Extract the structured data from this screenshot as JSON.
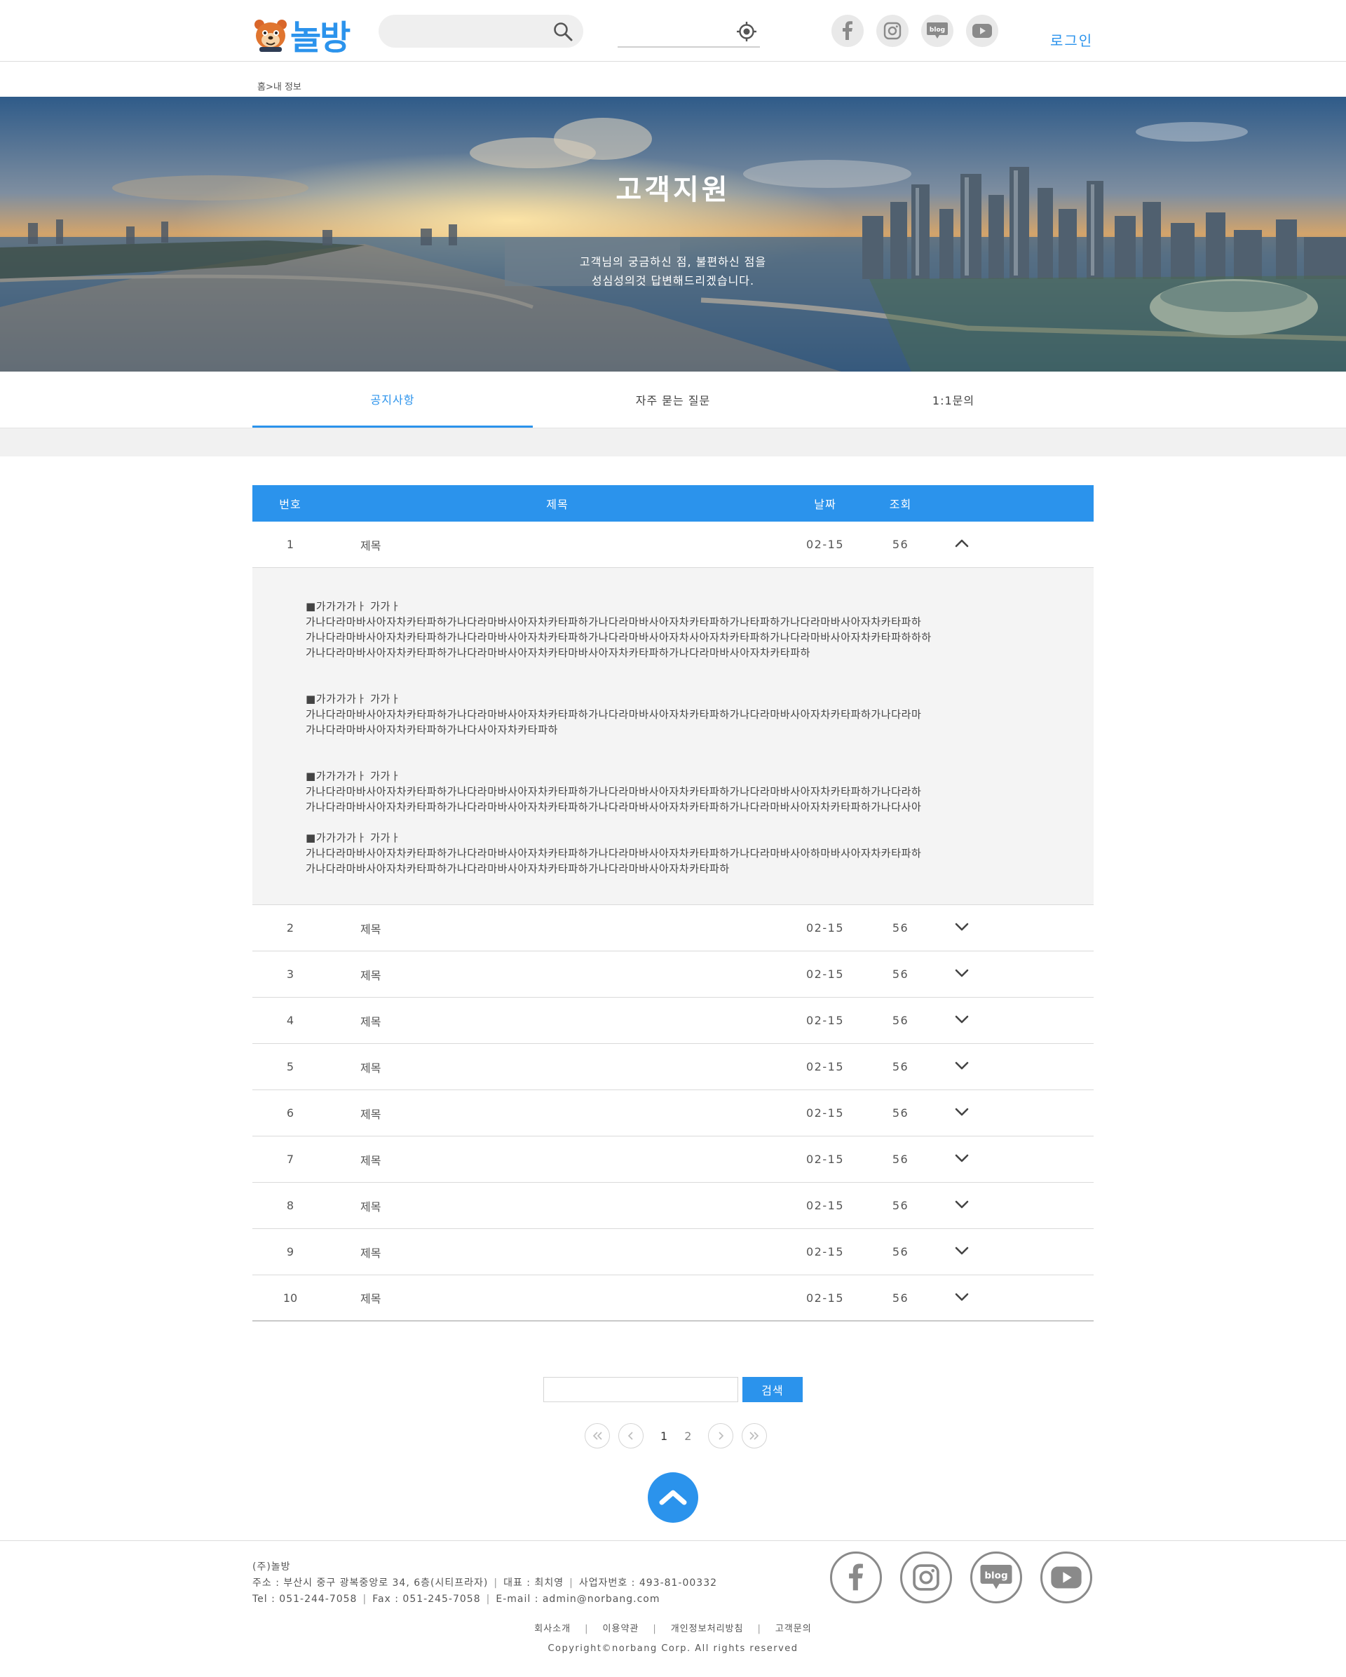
{
  "header": {
    "logo_text": "놀방",
    "search_placeholder": "",
    "location_placeholder": "",
    "sns": [
      "facebook-icon",
      "instagram-icon",
      "blog-icon",
      "youtube-icon"
    ],
    "login_label": "로그인",
    "blog_label": "blog"
  },
  "breadcrumb": "홈>내 정보",
  "hero": {
    "title": "고객지원",
    "desc_line1": "고객님의 궁금하신 점, 불편하신 점을",
    "desc_line2": "성심성의것 답변해드리겠습니다."
  },
  "tabs": [
    {
      "label": "공지사항",
      "active": true
    },
    {
      "label": "자주 묻는 질문",
      "active": false
    },
    {
      "label": "1:1문의",
      "active": false
    }
  ],
  "board": {
    "headers": {
      "num": "번호",
      "title": "제목",
      "date": "날짜",
      "views": "조회"
    },
    "rows": [
      {
        "num": "1",
        "title": "제목",
        "date": "02-15",
        "views": "56",
        "expanded": true
      },
      {
        "num": "2",
        "title": "제목",
        "date": "02-15",
        "views": "56"
      },
      {
        "num": "3",
        "title": "제목",
        "date": "02-15",
        "views": "56"
      },
      {
        "num": "4",
        "title": "제목",
        "date": "02-15",
        "views": "56"
      },
      {
        "num": "5",
        "title": "제목",
        "date": "02-15",
        "views": "56"
      },
      {
        "num": "6",
        "title": "제목",
        "date": "02-15",
        "views": "56"
      },
      {
        "num": "7",
        "title": "제목",
        "date": "02-15",
        "views": "56"
      },
      {
        "num": "8",
        "title": "제목",
        "date": "02-15",
        "views": "56"
      },
      {
        "num": "9",
        "title": "제목",
        "date": "02-15",
        "views": "56"
      },
      {
        "num": "10",
        "title": "제목",
        "date": "02-15",
        "views": "56"
      }
    ],
    "answer": [
      {
        "heading": "■가가가가ㅏ 가가ㅏ",
        "lines": [
          "가나다라마바사아자차카타파하가나다라마바사아자차카타파하가나다라마바사아자차카타파하가나타파하가나다라마바사아자차카타파하",
          "가나다라마바사아자차카타파하가나다라마바사아자차카타파하가나다라마바사아자차사아자차카타파하가나다라마바사아자차카타파하하하",
          "가나다라마바사아자차카타파하가나다라마바사아자차카타마바사아자차카타파하가나다라마바사아자차카타파하"
        ]
      },
      {
        "heading": "■가가가가ㅏ 가가ㅏ",
        "lines": [
          "가나다라마바사아자차카타파하가나다라마바사아자차카타파하가나다라마바사아자차카타파하가나다라마바사아자차카타파하가나다라마",
          "가나다라마바사아자차카타파하가나다사아자차카타파하"
        ]
      },
      {
        "heading": "■가가가가ㅏ 가가ㅏ",
        "lines": [
          "가나다라마바사아자차카타파하가나다라마바사아자차카타파하가나다라마바사아자차카타파하가나다라마바사아자차카타파하가나다라하",
          "가나다라마바사아자차카타파하가나다라마바사아자차카타파하가나다라마바사아자차카타파하가나다라마바사아자차카타파하가나다사아"
        ]
      },
      {
        "heading": "■가가가가ㅏ 가가ㅏ",
        "lines": [
          "가나다라마바사아자차카타파하가나다라마바사아자차카타파하가나다라마바사아자차카타파하가나다라마바사아하마바사아자차카타파하",
          "가나다라마바사아자차카타파하가나다라마바사아자차카타파하가나다라마바사아자차카타파하"
        ]
      }
    ]
  },
  "search": {
    "button_label": "검색",
    "input_value": ""
  },
  "pagination": {
    "pages": [
      "1",
      "2"
    ],
    "current": "1"
  },
  "footer": {
    "company": "(주)놀방",
    "address": "주소 : 부산시 중구 광복중앙로 34, 6층(시티프라자)",
    "ceo": "대표 : 최치영",
    "biz_no": "사업자번호 : 493-81-00332",
    "tel": "Tel : 051-244-7058",
    "fax": "Fax : 051-245-7058",
    "email": "E-mail : admin@norbang.com",
    "links": [
      "회사소개",
      "이용약관",
      "개인정보처리방침",
      "고객문의"
    ],
    "copyright": "Copyright©norbang Corp. All rights reserved",
    "sns": [
      "facebook-icon",
      "instagram-icon",
      "blog-icon",
      "youtube-icon"
    ],
    "blog_label": "blog"
  },
  "colors": {
    "accent": "#2b93ec",
    "header_border": "#dcdcdc",
    "answer_bg": "#f4f4f4"
  }
}
